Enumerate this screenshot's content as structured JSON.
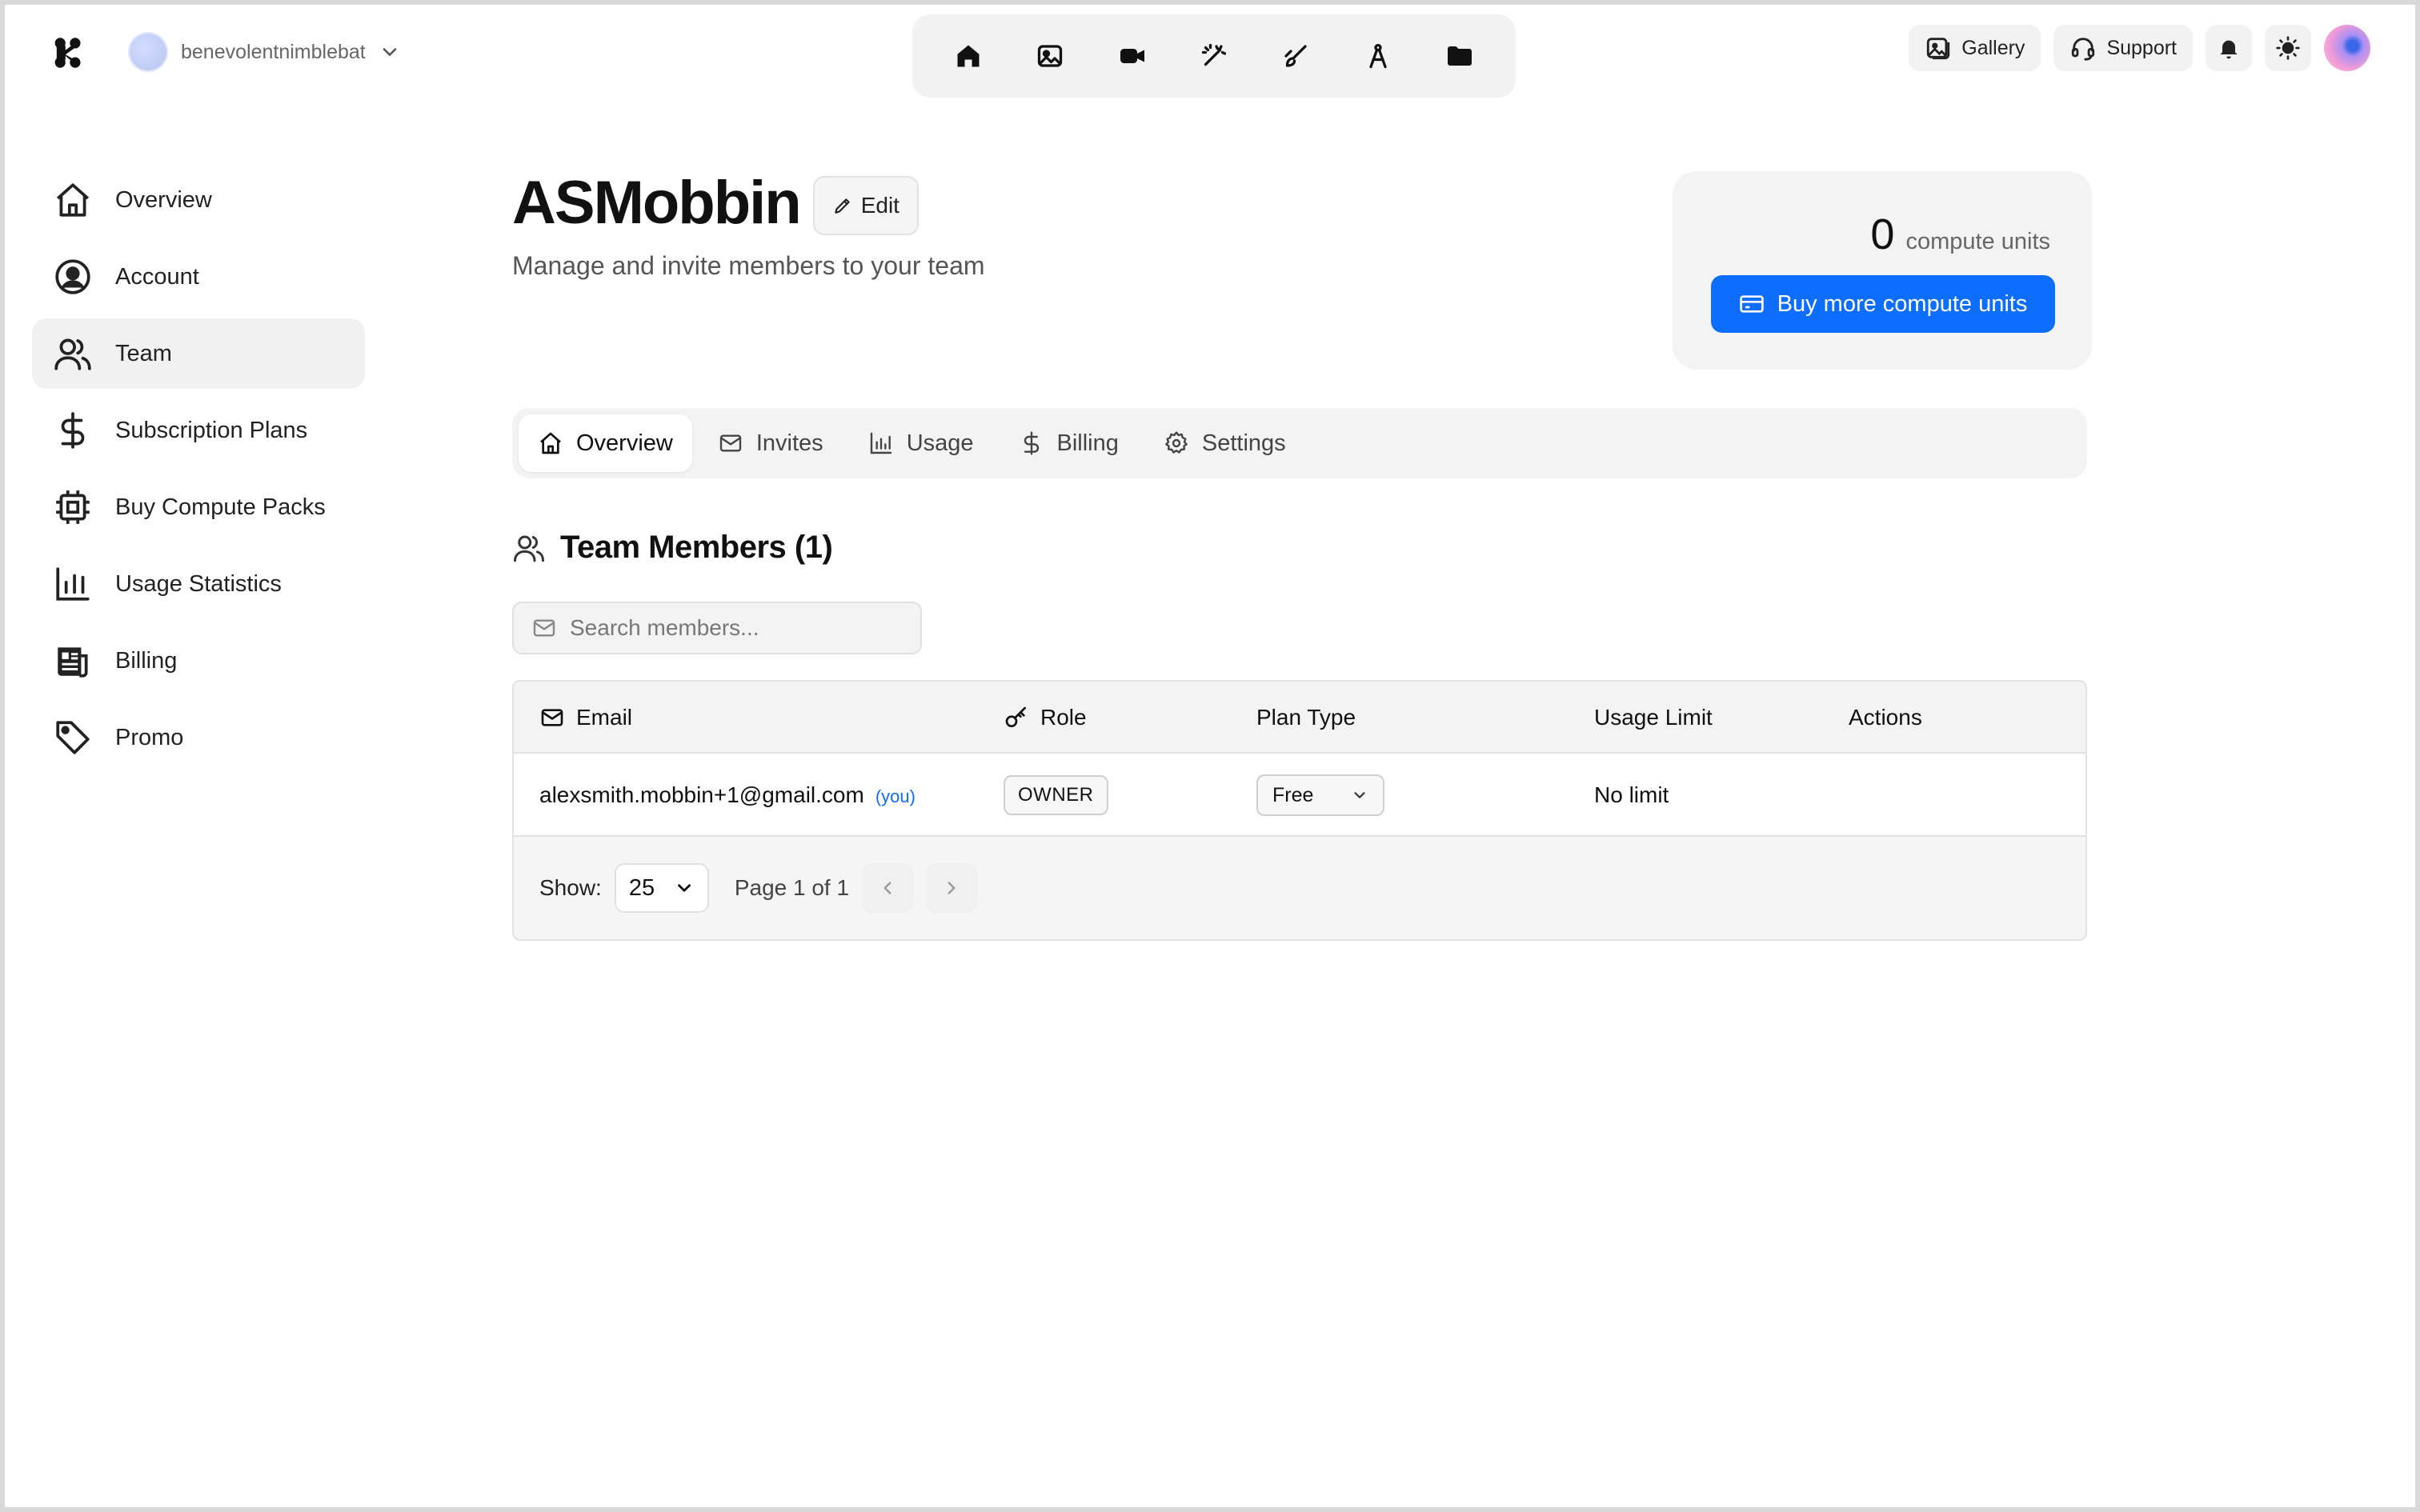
{
  "workspace": {
    "name": "benevolentnimblebat"
  },
  "top_nav": {
    "tools": [
      {
        "icon": "home-icon"
      },
      {
        "icon": "image-icon"
      },
      {
        "icon": "video-icon"
      },
      {
        "icon": "magic-wand-icon"
      },
      {
        "icon": "brush-icon"
      },
      {
        "icon": "compass-icon"
      },
      {
        "icon": "folder-icon"
      }
    ],
    "gallery_label": "Gallery",
    "support_label": "Support"
  },
  "sidebar": {
    "items": [
      {
        "label": "Overview",
        "icon": "house-icon",
        "active": false
      },
      {
        "label": "Account",
        "icon": "user-circle-icon",
        "active": false
      },
      {
        "label": "Team",
        "icon": "users-icon",
        "active": true
      },
      {
        "label": "Subscription Plans",
        "icon": "dollar-icon",
        "active": false
      },
      {
        "label": "Buy Compute Packs",
        "icon": "chip-icon",
        "active": false
      },
      {
        "label": "Usage Statistics",
        "icon": "bar-chart-icon",
        "active": false
      },
      {
        "label": "Billing",
        "icon": "receipt-icon",
        "active": false
      },
      {
        "label": "Promo",
        "icon": "tag-icon",
        "active": false
      }
    ]
  },
  "header": {
    "title": "ASMobbin",
    "edit_label": "Edit",
    "subtitle": "Manage and invite members to your team"
  },
  "compute": {
    "units": "0",
    "units_label": "compute units",
    "buy_label": "Buy more compute units"
  },
  "tabs": [
    {
      "label": "Overview",
      "icon": "house-icon",
      "active": true
    },
    {
      "label": "Invites",
      "icon": "mail-icon",
      "active": false
    },
    {
      "label": "Usage",
      "icon": "bar-chart-icon",
      "active": false
    },
    {
      "label": "Billing",
      "icon": "dollar-icon",
      "active": false
    },
    {
      "label": "Settings",
      "icon": "gear-icon",
      "active": false
    }
  ],
  "members": {
    "title": "Team Members (1)",
    "search_placeholder": "Search members...",
    "columns": {
      "email": "Email",
      "role": "Role",
      "plan_type": "Plan Type",
      "usage_limit": "Usage Limit",
      "actions": "Actions"
    },
    "rows": [
      {
        "email": "alexsmith.mobbin+1@gmail.com",
        "you_tag": "(you)",
        "role": "OWNER",
        "plan": "Free",
        "usage_limit": "No limit"
      }
    ],
    "pagination": {
      "show_label": "Show:",
      "page_size": "25",
      "page_info": "Page 1 of 1"
    }
  },
  "colors": {
    "accent": "#0d6efd",
    "surface": "#f3f3f3"
  }
}
